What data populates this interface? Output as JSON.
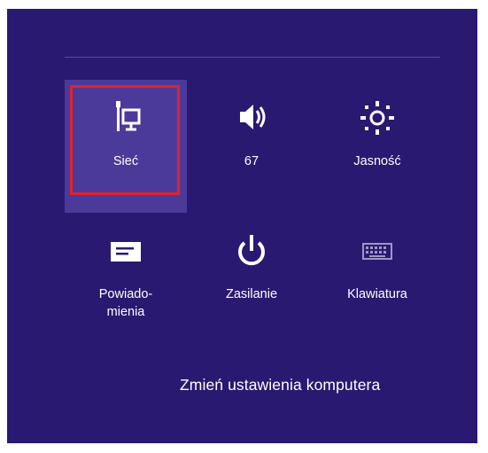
{
  "settings_pane": {
    "tiles": [
      {
        "label": "Sieć",
        "icon": "network-icon",
        "selected": true
      },
      {
        "label": "67",
        "icon": "volume-icon"
      },
      {
        "label": "Jasność",
        "icon": "brightness-icon"
      },
      {
        "label": "Powiado-",
        "label2": "mienia",
        "icon": "notifications-icon"
      },
      {
        "label": "Zasilanie",
        "icon": "power-icon"
      },
      {
        "label": "Klawiatura",
        "icon": "keyboard-icon"
      }
    ],
    "change_settings_link": "Zmień ustawienia komputera"
  },
  "colors": {
    "panel_bg": "#2a1971",
    "selected_tile_bg": "#4b3a9a",
    "highlight_border": "#e1232a",
    "text": "#ffffff"
  }
}
